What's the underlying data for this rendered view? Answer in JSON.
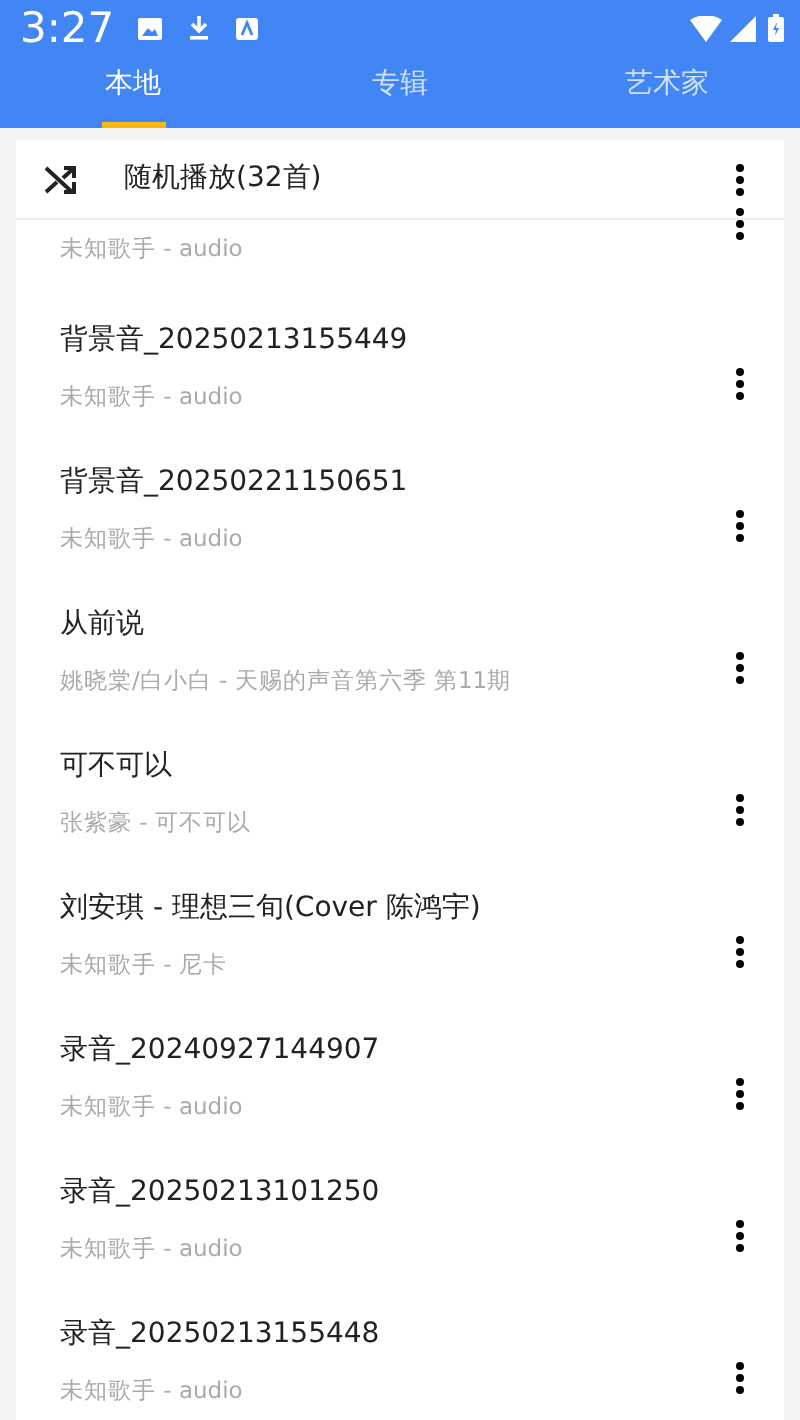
{
  "status_bar": {
    "time": "3:27"
  },
  "tabs": [
    {
      "label": "本地",
      "selected": true
    },
    {
      "label": "专辑",
      "selected": false
    },
    {
      "label": "艺术家",
      "selected": false
    }
  ],
  "shuffle": {
    "label": "随机播放(32首)"
  },
  "songs": [
    {
      "kind": "partial",
      "subtitle": "未知歌手 - audio"
    },
    {
      "kind": "full",
      "title": "背景音_20250213155449",
      "subtitle": "未知歌手 - audio"
    },
    {
      "kind": "full",
      "title": "背景音_20250221150651",
      "subtitle": "未知歌手 - audio"
    },
    {
      "kind": "full",
      "title": "从前说",
      "subtitle": "姚晓棠/白小白 - 天赐的声音第六季 第11期"
    },
    {
      "kind": "full",
      "title": "可不可以",
      "subtitle": "张紫豪 - 可不可以"
    },
    {
      "kind": "full",
      "title": "刘安琪 - 理想三旬(Cover 陈鸿宇)",
      "subtitle": "未知歌手 - 尼卡"
    },
    {
      "kind": "full",
      "title": "录音_20240927144907",
      "subtitle": "未知歌手 - audio"
    },
    {
      "kind": "full",
      "title": "录音_20250213101250",
      "subtitle": "未知歌手 - audio"
    },
    {
      "kind": "full",
      "title": "录音_20250213155448",
      "subtitle": "未知歌手 - audio"
    }
  ]
}
